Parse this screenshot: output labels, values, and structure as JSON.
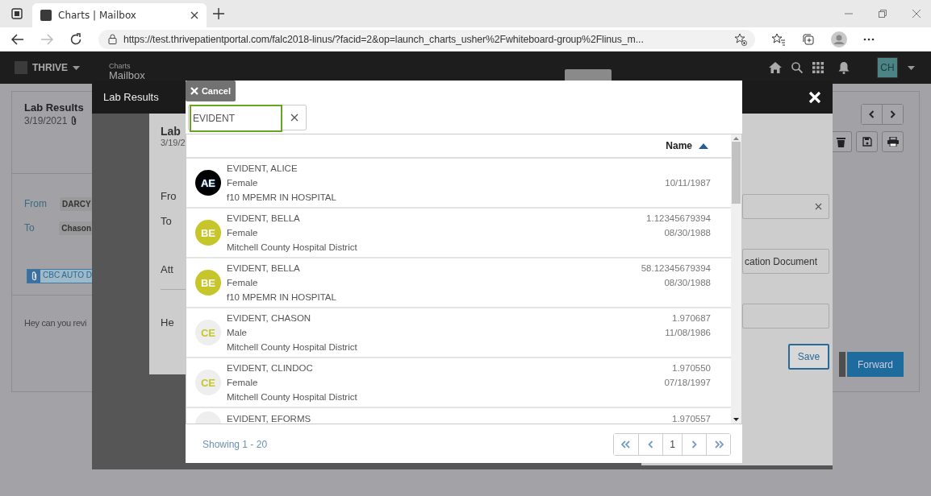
{
  "browser": {
    "tab_title": "Charts | Mailbox",
    "url": "https://test.thrivepatientportal.com/falc2018-linus/?facid=2&op=launch_charts_usher%2Fwhiteboard-group%2Flinus_m..."
  },
  "app_header": {
    "brand": "THRIVE",
    "section": "Charts",
    "page": "Mailbox",
    "avatar": "CH"
  },
  "message": {
    "title": "Lab Results",
    "date": "3/19/2021",
    "from_label": "From",
    "from_value": "DARCY",
    "to_label": "To",
    "to_value": "Chason",
    "attachment": "CBC AUTO D",
    "body": "Hey can you revi",
    "forward_button": "Forward"
  },
  "dialog": {
    "title": "Lab Results",
    "form": {
      "title": "Lab",
      "date": "3/19/2",
      "from_label": "Fro",
      "to_label": "To",
      "attach_label": "Att",
      "body_label": "He",
      "attachment_field": "cation Document",
      "save_button": "Save"
    }
  },
  "patient_picker": {
    "cancel_button": "Cancel",
    "search": {
      "value": "EVIDENT"
    },
    "sort_column": "Name",
    "rows": [
      {
        "name": "EVIDENT, ALICE",
        "gender": "Female",
        "facility": "f10 MPEMR IN HOSPITAL",
        "dob": "10/11/1987",
        "initials": "AE",
        "kind": "dark"
      },
      {
        "name": "EVIDENT, BELLA",
        "gender": "Female",
        "facility": "Mitchell County Hospital District",
        "number": "1.12345679394",
        "dob": "08/30/1988",
        "initials": "BE",
        "kind": "solid"
      },
      {
        "name": "EVIDENT, BELLA",
        "gender": "Female",
        "facility": "f10 MPEMR IN HOSPITAL",
        "number": "58.12345679394",
        "dob": "08/30/1988",
        "initials": "BE",
        "kind": "solid"
      },
      {
        "name": "EVIDENT, CHASON",
        "gender": "Male",
        "facility": "Mitchell County Hospital District",
        "number": "1.970687",
        "dob": "11/08/1986",
        "initials": "CE",
        "kind": "light"
      },
      {
        "name": "EVIDENT, CLINDOC",
        "gender": "Female",
        "facility": "Mitchell County Hospital District",
        "number": "1.970550",
        "dob": "07/18/1997",
        "initials": "CE",
        "kind": "light"
      },
      {
        "name": "EVIDENT, EFORMS",
        "number": "1.970557",
        "kind": "light"
      }
    ],
    "showing": "Showing 1 - 20",
    "page": "1"
  }
}
